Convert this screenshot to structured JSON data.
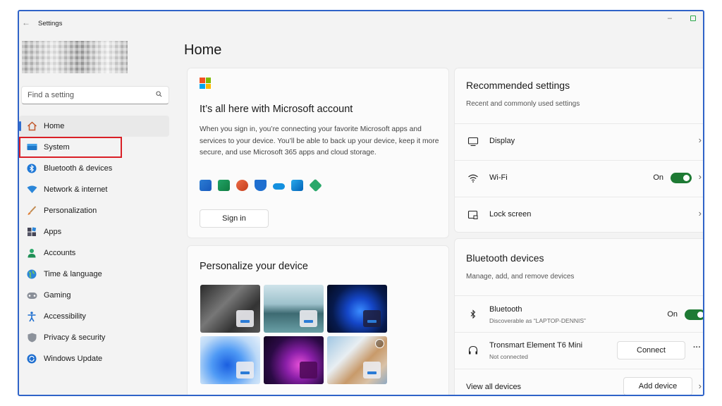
{
  "window": {
    "title": "Settings"
  },
  "search": {
    "placeholder": "Find a setting"
  },
  "sidebar": {
    "items": [
      {
        "label": "Home",
        "icon": "home-icon"
      },
      {
        "label": "System",
        "icon": "system-icon"
      },
      {
        "label": "Bluetooth & devices",
        "icon": "bluetooth-icon"
      },
      {
        "label": "Network & internet",
        "icon": "network-icon"
      },
      {
        "label": "Personalization",
        "icon": "brush-icon"
      },
      {
        "label": "Apps",
        "icon": "apps-icon"
      },
      {
        "label": "Accounts",
        "icon": "accounts-icon"
      },
      {
        "label": "Time & language",
        "icon": "globe-icon"
      },
      {
        "label": "Gaming",
        "icon": "gamepad-icon"
      },
      {
        "label": "Accessibility",
        "icon": "accessibility-icon"
      },
      {
        "label": "Privacy & security",
        "icon": "shield-icon"
      },
      {
        "label": "Windows Update",
        "icon": "update-icon"
      }
    ]
  },
  "main": {
    "page_title": "Home",
    "ms_account": {
      "title": "It’s all here with Microsoft account",
      "description": "When you sign in, you’re connecting your favorite Microsoft apps and services to your device. You’ll be able to back up your device, keep it more secure, and use Microsoft 365 apps and cloud storage.",
      "sign_in": "Sign in"
    },
    "personalize": {
      "title": "Personalize your device"
    },
    "recommended": {
      "title": "Recommended settings",
      "subtitle": "Recent and commonly used settings",
      "rows": [
        {
          "label": "Display",
          "icon": "monitor-icon"
        },
        {
          "label": "Wi-Fi",
          "icon": "wifi-icon",
          "state": "On"
        },
        {
          "label": "Lock screen",
          "icon": "lock-screen-icon"
        }
      ]
    },
    "bluetooth": {
      "title": "Bluetooth devices",
      "subtitle": "Manage, add, and remove devices",
      "bt_label": "Bluetooth",
      "bt_sub": "Discoverable as “LAPTOP-DENNIS”",
      "bt_state": "On",
      "device_name": "Tronsmart Element T6 Mini",
      "device_status": "Not connected",
      "connect": "Connect",
      "more": "···",
      "view_all": "View all devices",
      "add_device": "Add device"
    }
  },
  "colors": {
    "accent": "#2f6fd0",
    "toggle_on": "#1e7a34",
    "highlight": "#d91f26"
  }
}
